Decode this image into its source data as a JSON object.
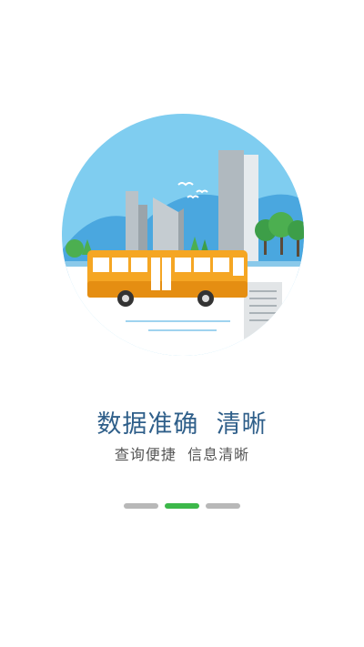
{
  "headline": "数据准确  清晰",
  "subline": "查询便捷  信息清晰",
  "pager": {
    "count": 3,
    "active_index": 1,
    "colors": {
      "active": "#3cb84a",
      "inactive": "#b8b8b8"
    }
  },
  "illustration": {
    "subject": "city-bus-scene",
    "colors": {
      "sky": "#7fcdf0",
      "bus": "#f5a623",
      "trees": "#4caf50",
      "buildings": "#b9c2c8"
    }
  }
}
